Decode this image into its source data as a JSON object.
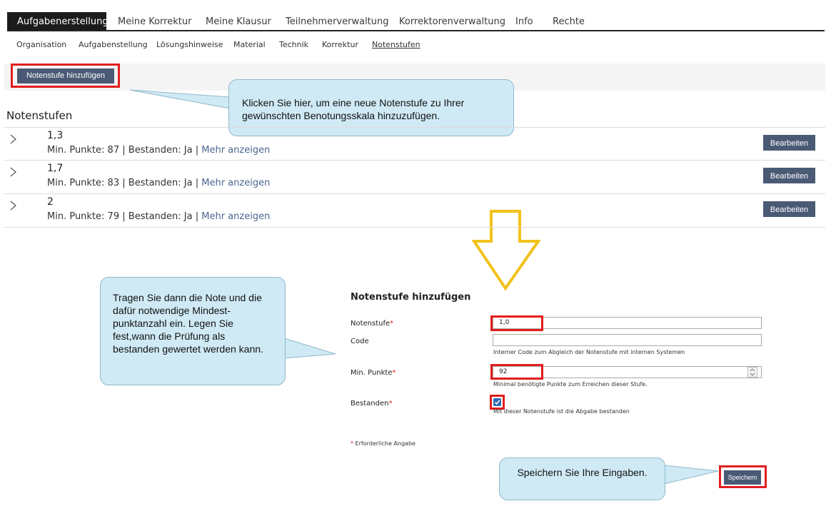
{
  "main_tabs": [
    "Aufgabenerstellung",
    "Meine Korrektur",
    "Meine Klausur",
    "Teilnehmerverwaltung",
    "Korrektorenverwaltung",
    "Info",
    "Rechte"
  ],
  "sub_tabs": [
    "Organisation",
    "Aufgabenstellung",
    "Lösungshinweise",
    "Material",
    "Technik",
    "Korrektur",
    "Notenstufen"
  ],
  "toolbar": {
    "add_button": "Notenstufe hinzufügen"
  },
  "list": {
    "title": "Notenstufen",
    "rows": [
      {
        "grade": "1,3",
        "min_label": "Min. Punkte: 87",
        "sep1": "|",
        "passed_label": "Bestanden: Ja",
        "sep2": "|",
        "more": "Mehr anzeigen",
        "edit": "Bearbeiten"
      },
      {
        "grade": "1,7",
        "min_label": "Min. Punkte: 83",
        "sep1": "|",
        "passed_label": "Bestanden: Ja",
        "sep2": "|",
        "more": "Mehr anzeigen",
        "edit": "Bearbeiten"
      },
      {
        "grade": "2",
        "min_label": "Min. Punkte: 79",
        "sep1": "|",
        "passed_label": "Bestanden: Ja",
        "sep2": "|",
        "more": "Mehr anzeigen",
        "edit": "Bearbeiten"
      }
    ]
  },
  "callouts": {
    "add": "Klicken Sie hier, um eine neue Notenstufe zu Ihrer gewünschten Benotungsskala hinzuzufügen.",
    "enter": "Tragen Sie dann die Note und die dafür notwendige Mindest-punktanzahl ein. Legen Sie fest,wann die Prüfung als bestanden gewertet werden kann.",
    "save": "Speichern Sie Ihre Eingaben."
  },
  "form": {
    "title": "Notenstufe hinzufügen",
    "grade_label": "Notenstufe",
    "grade_value": "1,0",
    "code_label": "Code",
    "code_value": "",
    "code_hint": "Interner Code zum Abgleich der Notenstufe mit internen Systemen",
    "min_label": "Min. Punkte",
    "min_value": "92",
    "min_hint": "Minimal benötigte Punkte zum Erreichen dieser Stufe.",
    "passed_label": "Bestanden",
    "passed_checked": true,
    "passed_hint": "Mit dieser Notenstufe ist die Abgabe bestanden",
    "required_star": "*",
    "required_note": "Erforderliche Angabe",
    "save_button": "Speichern"
  },
  "colors": {
    "button_bg": "#4a5a75",
    "highlight": "#e21e1e",
    "callout_bg": "#cfeaf5",
    "arrow": "#f2c21b"
  },
  "icons": [
    "chevron-right-icon",
    "down-arrow-icon",
    "checkmark-icon",
    "spinner-arrows-icon"
  ]
}
